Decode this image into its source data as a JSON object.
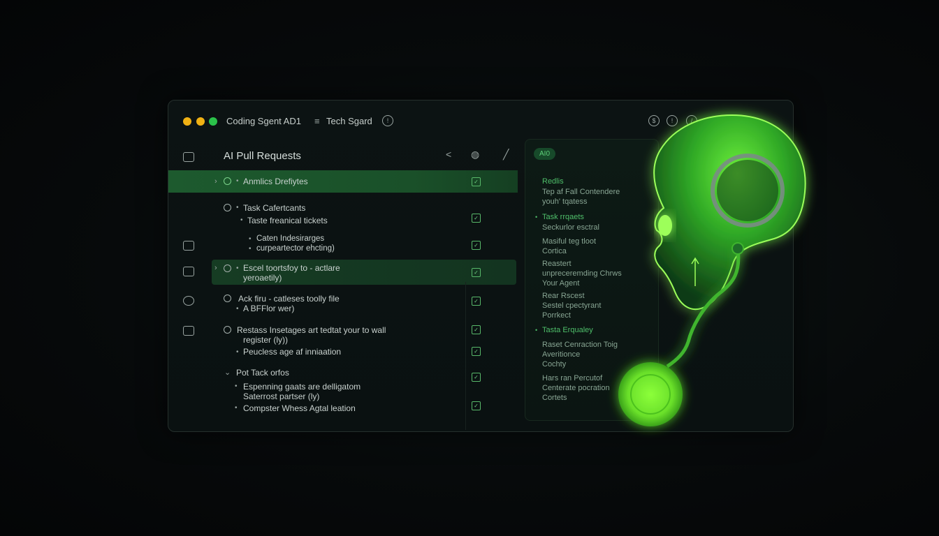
{
  "window": {
    "app_title": "Coding Sgent AD1",
    "menu_label": "Tech Sgard",
    "dot_colors": [
      "#f0b114",
      "#f0b114",
      "#2bc24a"
    ]
  },
  "panel": {
    "title": "AI Pull Requests"
  },
  "list": {
    "item1": "Anmlics Drefiytes",
    "item2": "Task Cafertcants",
    "item2_sub1": "Taste freanical tickets",
    "item2_sub2a": "Caten Indesirarges",
    "item2_sub2b": "curpeartector ehcting)",
    "item3a": "Escel toortsfoy to - actlare",
    "item3b": "yeroaetily)",
    "item4a": "Ack firu - catleses toolly file",
    "item4b": "A BFFlor wer)",
    "item5a": "Restass Insetages art tedtat your to wall",
    "item5b": "register (ly))",
    "item5_sub": "Peucless age af inniaation",
    "item6": "Pot Tack orfos",
    "item6_sub1a": "Espenning gaats are delligatom",
    "item6_sub1b": "Saterrost partser (ly)",
    "item6_sub2": "Compster Whess Agtal leation"
  },
  "right_panel": {
    "pill": "AI0",
    "l1": "Redlis",
    "l2": "Tep af Fall Contendere",
    "l3": "youh' tqatess",
    "l4": "Task rrqaets",
    "l5": "Seckurlor esctral",
    "l6": "Masiful teg tloot",
    "l7": "Cortica",
    "l8": "Reastert",
    "l9": "unpreceremding Chrws",
    "l10": "Your Agent",
    "l11": "Rear Rscest",
    "l12": "Sestel cpectyrant",
    "l13": "Porrkect",
    "l14": "Tasta Erqualey",
    "l15": "Raset Cenraction Toig",
    "l16": "Averitionce",
    "l17": "Cochty",
    "l18": "Hars ran Percutof",
    "l19": "Centerate pocration",
    "l20": "Cortets"
  },
  "colors": {
    "accent": "#5fe04a",
    "highlight_row": "#1d5a2e"
  }
}
